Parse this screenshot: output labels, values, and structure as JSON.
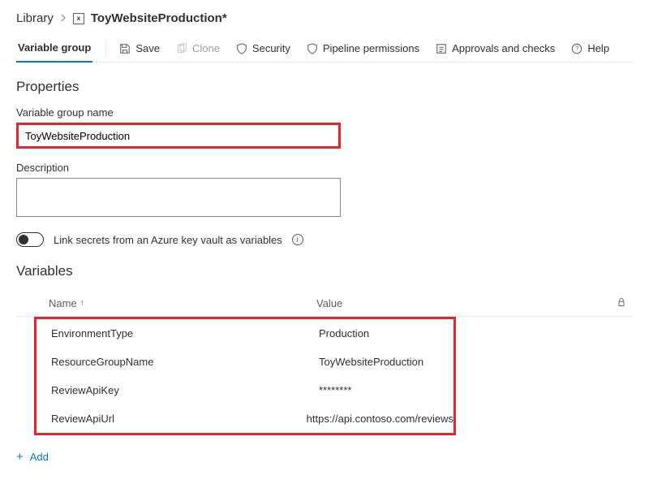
{
  "breadcrumb": {
    "root": "Library",
    "current": "ToyWebsiteProduction*"
  },
  "tab": {
    "label": "Variable group"
  },
  "toolbar": {
    "save": "Save",
    "clone": "Clone",
    "security": "Security",
    "pipeline_permissions": "Pipeline permissions",
    "approvals": "Approvals and checks",
    "help": "Help"
  },
  "properties": {
    "heading": "Properties",
    "name_label": "Variable group name",
    "name_value": "ToyWebsiteProduction",
    "desc_label": "Description",
    "desc_value": "",
    "link_keyvault": "Link secrets from an Azure key vault as variables"
  },
  "variables": {
    "heading": "Variables",
    "col_name": "Name",
    "col_value": "Value",
    "rows": [
      {
        "name": "EnvironmentType",
        "value": "Production"
      },
      {
        "name": "ResourceGroupName",
        "value": "ToyWebsiteProduction"
      },
      {
        "name": "ReviewApiKey",
        "value": "********"
      },
      {
        "name": "ReviewApiUrl",
        "value": "https://api.contoso.com/reviews"
      }
    ],
    "add": "Add"
  }
}
